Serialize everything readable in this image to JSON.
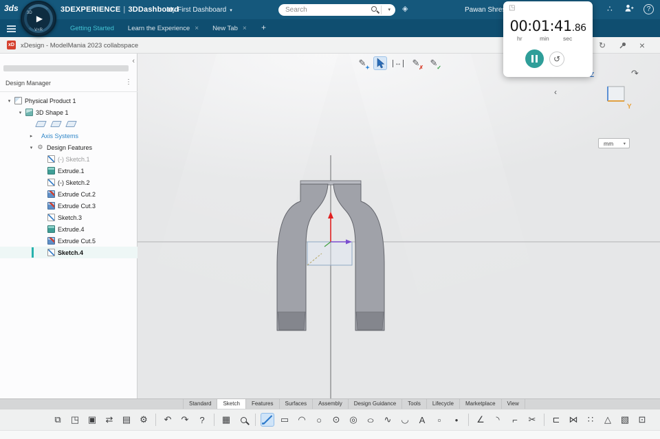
{
  "topbar": {
    "logo": "3ds",
    "brand": "3DEXPERIENCE",
    "divider": "|",
    "app": "3DDashboard",
    "dashboard": "My First Dashboard",
    "search_placeholder": "Search",
    "user": "Pawan Shres"
  },
  "compass": {
    "play": "▶",
    "top": "3D",
    "bottom": "V+R"
  },
  "tabsbar": {
    "tabs": [
      {
        "label": "Getting Started",
        "active": true
      },
      {
        "label": "Learn the Experience",
        "closable": true
      },
      {
        "label": "New Tab",
        "closable": true
      }
    ]
  },
  "appbar": {
    "logo": "xD",
    "title": "xDesign - ModelMania 2023 collabspace"
  },
  "timer": {
    "time": "00:01:41",
    "fraction": ".86",
    "units": [
      "hr",
      "min",
      "sec"
    ]
  },
  "design_tree": {
    "header": "Design Manager",
    "items": [
      {
        "label": "Physical Product 1",
        "level": 0,
        "caret": "▾",
        "type": "product"
      },
      {
        "label": "3D Shape 1",
        "level": 1,
        "caret": "▾",
        "type": "shape"
      },
      {
        "planes": true,
        "level": 2
      },
      {
        "label": "Axis Systems",
        "level": 2,
        "caret": "▸",
        "type": "axis",
        "class": "axis-label"
      },
      {
        "label": "Design Features",
        "level": 2,
        "caret": "▾",
        "type": "features",
        "glyph": "⚙"
      },
      {
        "label": "(-) Sketch.1",
        "level": 3,
        "type": "sketch",
        "class": "dim"
      },
      {
        "label": "Extrude.1",
        "level": 3,
        "type": "extrude"
      },
      {
        "label": "(-) Sketch.2",
        "level": 3,
        "type": "sketch"
      },
      {
        "label": "Extrude Cut.2",
        "level": 3,
        "type": "cut"
      },
      {
        "label": "Extrude Cut.3",
        "level": 3,
        "type": "cut"
      },
      {
        "label": "Sketch.3",
        "level": 3,
        "type": "sketch"
      },
      {
        "label": "Extrude.4",
        "level": 3,
        "type": "extrude"
      },
      {
        "label": "Extrude Cut.5",
        "level": 3,
        "type": "cut"
      },
      {
        "label": "Sketch.4",
        "level": 3,
        "type": "sketch",
        "active": true
      }
    ]
  },
  "viewport": {
    "units": "mm",
    "axis_z": "Z",
    "axis_y": "Y",
    "tools": [
      {
        "name": "sketch-assist-icon",
        "base": "✎",
        "badge": "✦",
        "badge_color": "#2f86d8"
      },
      {
        "name": "select-icon",
        "cursor": true,
        "active": true
      },
      {
        "name": "dimension-icon",
        "base": "↔",
        "cls": "dimbars"
      },
      {
        "name": "sketch-error-icon",
        "base": "✎",
        "badge": "✗",
        "badge_color": "#d8402c"
      },
      {
        "name": "sketch-validate-icon",
        "base": "✎",
        "badge": "✓",
        "badge_color": "#2f9e3e"
      }
    ]
  },
  "bottom_tabs": {
    "active": "Sketch",
    "tabs": [
      "Standard",
      "Sketch",
      "Features",
      "Surfaces",
      "Assembly",
      "Design Guidance",
      "Tools",
      "Lifecycle",
      "Marketplace",
      "View"
    ]
  },
  "toolbar": {
    "icons": [
      {
        "name": "design-share-icon",
        "glyph": "⧉"
      },
      {
        "name": "insert-icon",
        "glyph": "◳"
      },
      {
        "name": "save-icon",
        "glyph": "▣"
      },
      {
        "name": "update-icon",
        "glyph": "⇄"
      },
      {
        "name": "capture-icon",
        "glyph": "▤"
      },
      {
        "name": "preferences-icon",
        "glyph": "⚙"
      },
      {
        "divider": true
      },
      {
        "name": "undo-icon",
        "glyph": "↶"
      },
      {
        "name": "redo-icon",
        "glyph": "↷"
      },
      {
        "name": "help-tool-icon",
        "glyph": "?"
      },
      {
        "divider": true
      },
      {
        "name": "grid-input-icon",
        "glyph": "▦"
      },
      {
        "name": "search-tools-icon",
        "mag": true
      },
      {
        "divider": true
      },
      {
        "name": "line-tool-icon",
        "line": true,
        "active": true
      },
      {
        "name": "rectangle-tool-icon",
        "glyph": "▭"
      },
      {
        "name": "slot-tool-icon",
        "glyph": "◠"
      },
      {
        "name": "circle-tool-icon",
        "glyph": "○"
      },
      {
        "name": "center-circle-tool-icon",
        "glyph": "⊙"
      },
      {
        "name": "concentric-circle-tool-icon",
        "glyph": "◎"
      },
      {
        "name": "ellipse-tool-icon",
        "glyph": "○",
        "cls": "stretch"
      },
      {
        "name": "spline-tool-icon",
        "glyph": "∿"
      },
      {
        "name": "arc-tool-icon",
        "glyph": "◡"
      },
      {
        "name": "text-tool-icon",
        "glyph": "A"
      },
      {
        "name": "construction-tool-icon",
        "glyph": "▫"
      },
      {
        "name": "point-tool-icon",
        "glyph": "•"
      },
      {
        "divider": true
      },
      {
        "name": "corner-tool-icon",
        "glyph": "∠"
      },
      {
        "name": "fillet-tool-icon",
        "glyph": "◝"
      },
      {
        "name": "chamfer-tool-icon",
        "glyph": "⌐"
      },
      {
        "name": "trim-tool-icon",
        "glyph": "✂"
      },
      {
        "divider": true
      },
      {
        "name": "offset-tool-icon",
        "glyph": "⊏"
      },
      {
        "name": "mirror-tool-icon",
        "glyph": "⋈"
      },
      {
        "name": "pattern-tool-icon",
        "glyph": "∷"
      },
      {
        "name": "constraint-tool-icon",
        "glyph": "△"
      },
      {
        "name": "solid-preview-icon",
        "glyph": "▧"
      },
      {
        "name": "exit-sketch-icon",
        "glyph": "⊡"
      }
    ]
  },
  "icons": {
    "caret_down": "▾",
    "chevron_left": "‹",
    "rotate_view": "↷",
    "refresh": "↻",
    "close": "×",
    "menu_dots": "⋮",
    "collapse_left": "‹",
    "plus": "+",
    "tag": "◈",
    "share": "⇗",
    "network": "∴",
    "help": "?",
    "popout": "◳",
    "reset": "↺"
  }
}
